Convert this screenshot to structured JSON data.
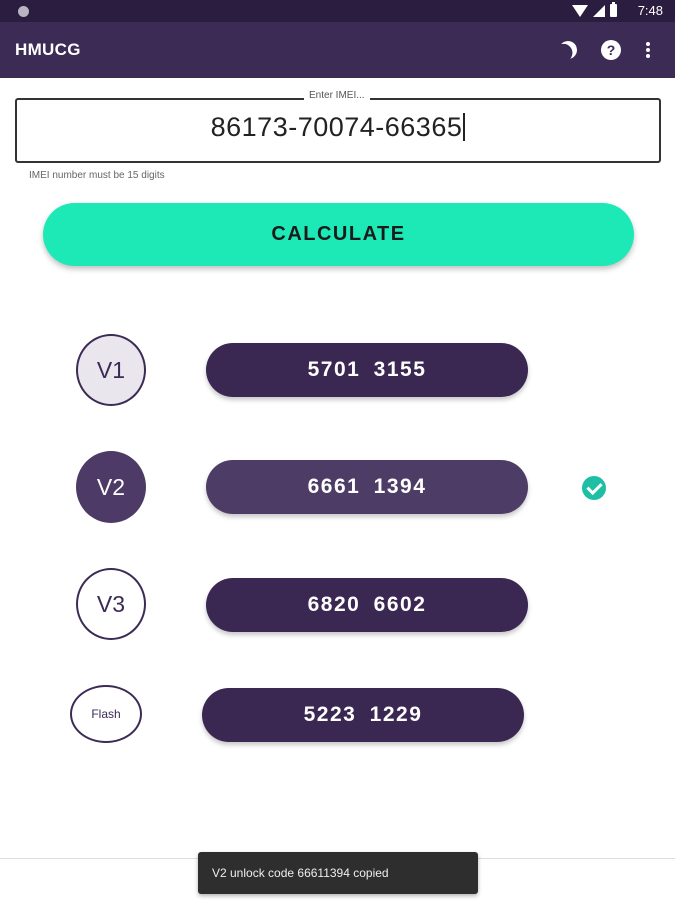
{
  "status_bar": {
    "time": "7:48"
  },
  "app_bar": {
    "title": "HMUCG",
    "icons": [
      "moon-icon",
      "help-icon",
      "more-vert-icon"
    ]
  },
  "imei": {
    "label": "Enter IMEI...",
    "value": "86173-70074-66365",
    "hint": "IMEI number must be 15 digits"
  },
  "calculate_label": "CALCULATE",
  "versions": [
    {
      "label": "V1",
      "code": "5701  3155",
      "selected": false
    },
    {
      "label": "V2",
      "code": "6661  1394",
      "selected": true
    },
    {
      "label": "V3",
      "code": "6820  6602",
      "selected": false
    },
    {
      "label": "Flash",
      "code": "5223  1229",
      "selected": false
    }
  ],
  "toast": "V2 unlock code 66611394 copied",
  "colors": {
    "primary_dark": "#2b1d3f",
    "primary": "#3c2b55",
    "accent": "#1de9b6",
    "check": "#1fbfa5"
  }
}
